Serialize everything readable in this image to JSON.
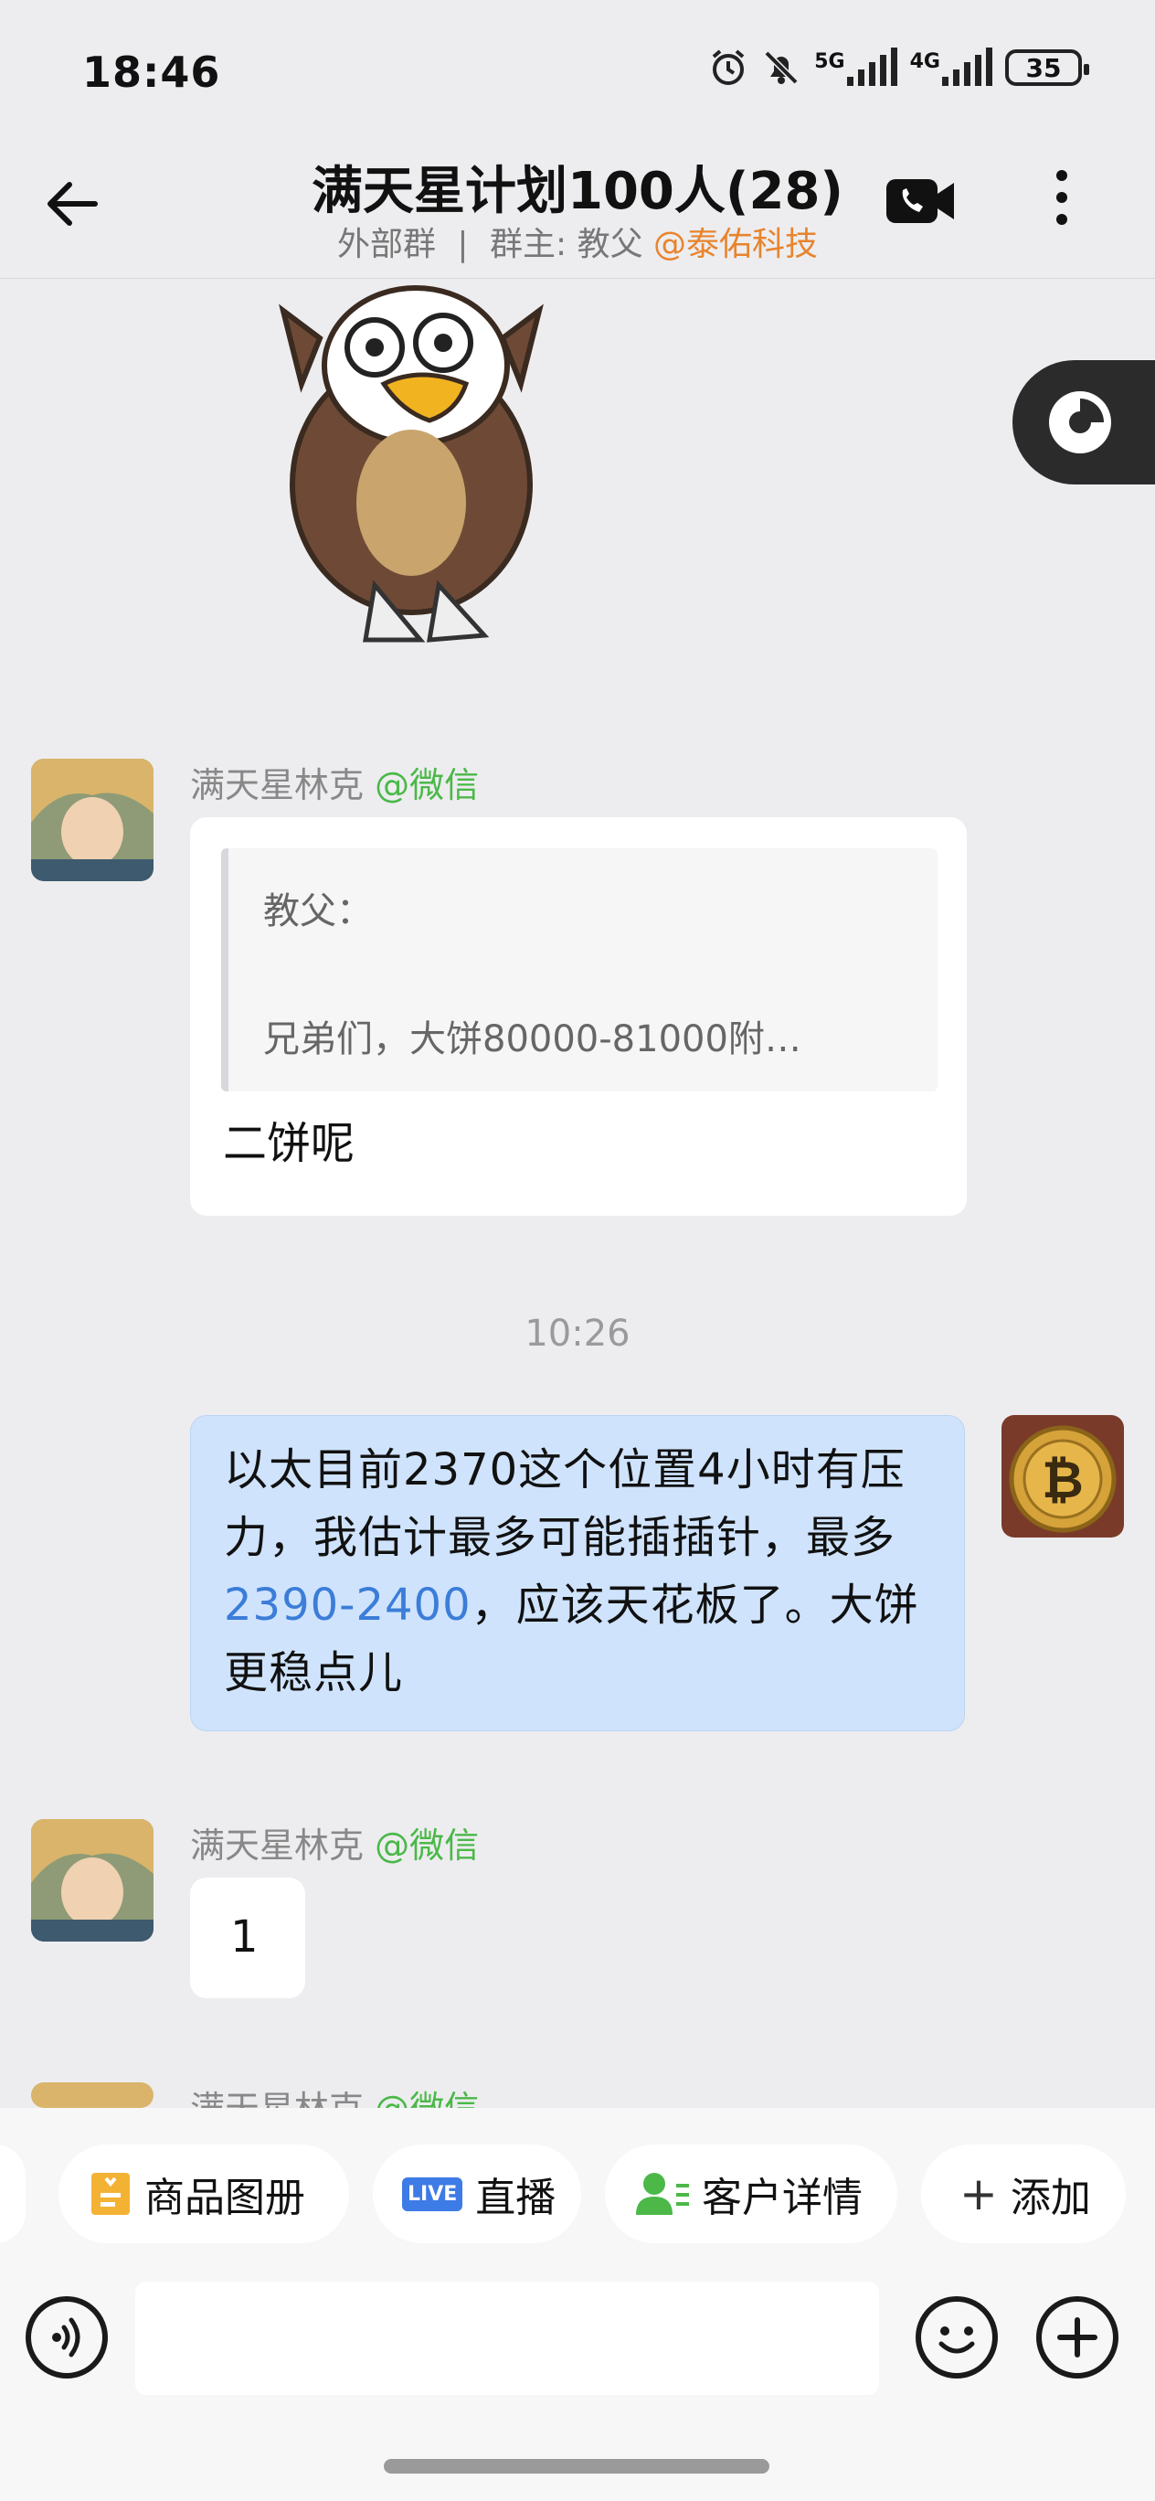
{
  "status_bar": {
    "time": "18:46",
    "sig1": "5G",
    "sig2": "4G",
    "battery": "35"
  },
  "header": {
    "title": "满天星计划100人(28)",
    "group_type": "外部群",
    "separator": "|",
    "owner_label": "群主: 教父",
    "owner_org": "@泰佑科技"
  },
  "messages": [
    {
      "sender": "满天星林克",
      "source": "@微信",
      "quote_name": "教父：",
      "quote_text": "兄弟们，大饼80000-81000附…",
      "text": "二饼呢"
    },
    {
      "timestamp": "10:26",
      "text_before": "以太目前2370这个位置4小时有压力，我估计最多可能插插针，最多",
      "link": "2390-2400",
      "text_after": "，应该天花板了。大饼更稳点儿"
    },
    {
      "sender": "满天星林克",
      "source": "@微信",
      "text": "1"
    },
    {
      "sender": "满天星林克",
      "source": "@微信"
    }
  ],
  "toolbar": {
    "chips": [
      {
        "label": "商品图册",
        "icon": "catalog-icon"
      },
      {
        "label": "直播",
        "icon": "live-icon",
        "badge": "LIVE"
      },
      {
        "label": "客户详情",
        "icon": "customer-icon"
      },
      {
        "label": "添加",
        "icon": "plus-icon",
        "prefix": "+"
      }
    ]
  },
  "colors": {
    "source_green": "#4bb848",
    "org_orange": "#e8842d",
    "link_blue": "#3b7dd8",
    "sent_bubble": "#cfe3fc"
  }
}
